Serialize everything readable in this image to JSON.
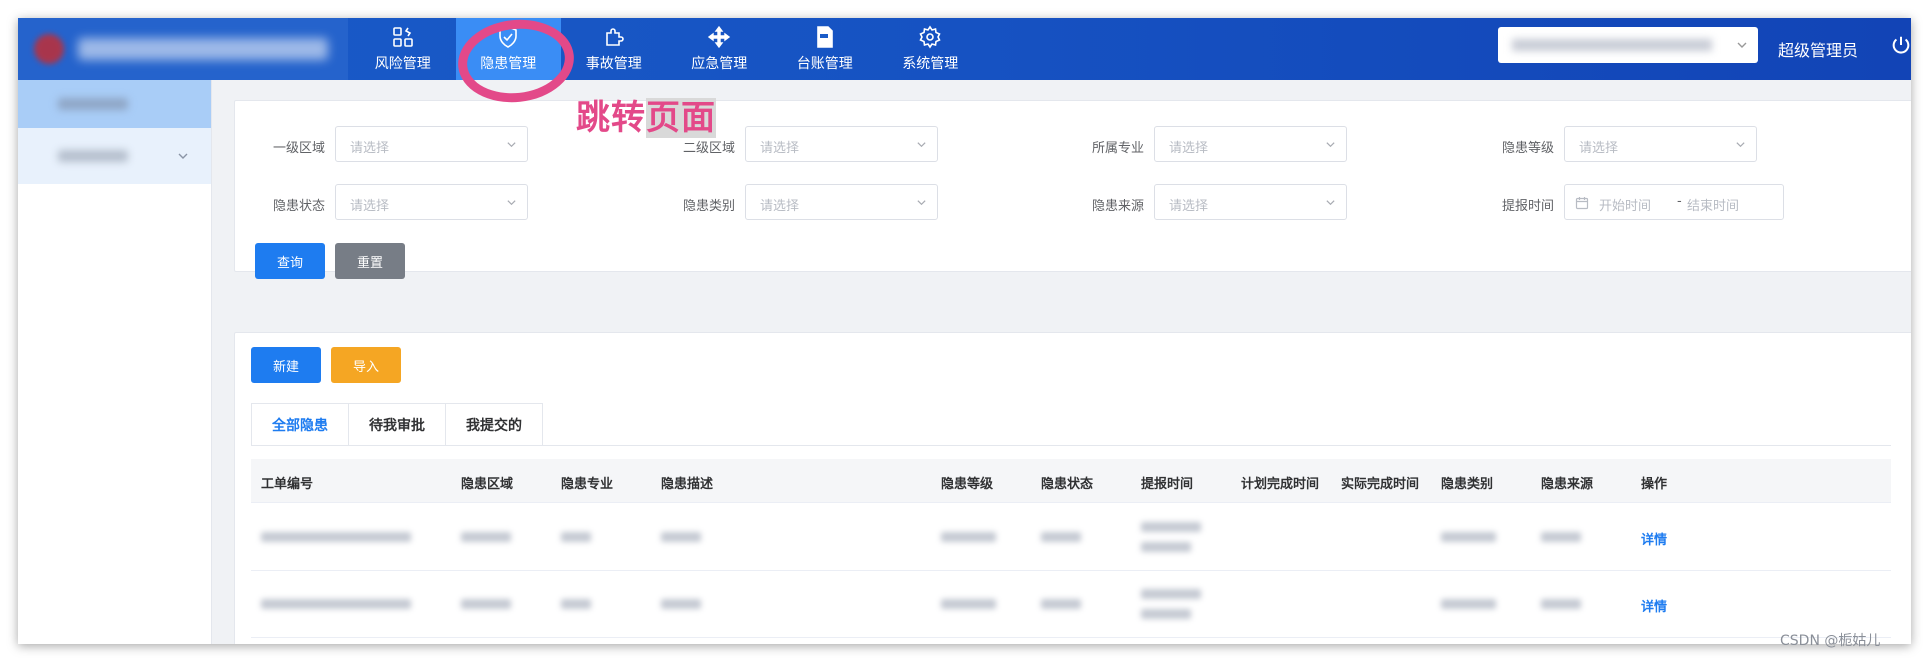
{
  "header": {
    "nav": [
      {
        "label": "风险管理",
        "icon": "risk-icon"
      },
      {
        "label": "隐患管理",
        "icon": "check-shield-icon"
      },
      {
        "label": "事故管理",
        "icon": "puzzle-icon"
      },
      {
        "label": "应急管理",
        "icon": "move-arrows-icon"
      },
      {
        "label": "台账管理",
        "icon": "zip-file-icon"
      },
      {
        "label": "系统管理",
        "icon": "gear-icon"
      }
    ],
    "active_nav": "隐患管理",
    "user_name": "超级管理员"
  },
  "annotation": {
    "text_part1": "跳转",
    "text_part2": "页面",
    "color": "#e34989"
  },
  "filters": {
    "level1_area_label": "一级区域",
    "level2_area_label": "二级区域",
    "specialty_label": "所属专业",
    "hazard_level_label": "隐患等级",
    "hazard_status_label": "隐患状态",
    "hazard_category_label": "隐患类别",
    "hazard_source_label": "隐患来源",
    "report_time_label": "提报时间",
    "placeholder": "请选择",
    "start_time_placeholder": "开始时间",
    "end_time_placeholder": "结束时间",
    "range_separator": "-",
    "query_label": "查询",
    "reset_label": "重置"
  },
  "list": {
    "new_label": "新建",
    "import_label": "导入",
    "tabs": [
      "全部隐患",
      "待我审批",
      "我提交的"
    ],
    "active_tab": "全部隐患",
    "columns": [
      "工单编号",
      "隐患区域",
      "隐患专业",
      "隐患描述",
      "隐患等级",
      "隐患状态",
      "提报时间",
      "计划完成时间",
      "实际完成时间",
      "隐患类别",
      "隐患来源",
      "操作"
    ],
    "row_action": "详情",
    "row_count": 2
  },
  "watermark": "CSDN @栀姑儿",
  "colors": {
    "header_blue": "#1652c2",
    "active_nav": "#3a8df5",
    "primary": "#1e7cf0",
    "warning": "#f5a623",
    "neutral_button": "#777d86"
  }
}
